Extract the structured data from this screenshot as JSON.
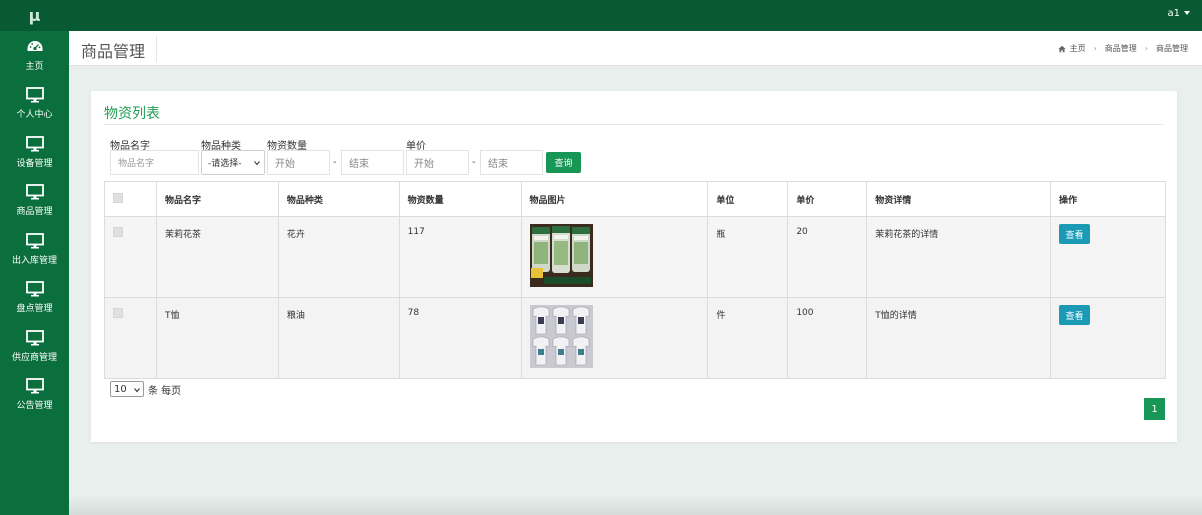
{
  "app": {
    "logo": "μ",
    "user": "a1"
  },
  "sidebar": {
    "items": [
      {
        "label": "主页",
        "icon": "dashboard-icon"
      },
      {
        "label": "个人中心",
        "icon": "monitor-icon"
      },
      {
        "label": "设备管理",
        "icon": "monitor-icon"
      },
      {
        "label": "商品管理",
        "icon": "monitor-icon"
      },
      {
        "label": "出入库管理",
        "icon": "monitor-icon"
      },
      {
        "label": "盘点管理",
        "icon": "monitor-icon"
      },
      {
        "label": "供应商管理",
        "icon": "monitor-icon"
      },
      {
        "label": "公告管理",
        "icon": "monitor-icon"
      }
    ]
  },
  "header": {
    "title": "商品管理",
    "breadcrumb": [
      "主页",
      "商品管理",
      "商品管理"
    ]
  },
  "panel": {
    "title": "物资列表",
    "filters": {
      "name_label": "物品名字",
      "name_placeholder": "物品名字",
      "type_label": "物品种类",
      "type_selected": "-请选择-",
      "qty_label": "物资数量",
      "qty_start": "开始",
      "qty_end": "结束",
      "price_label": "单价",
      "price_start": "开始",
      "price_end": "结束",
      "dash": "-",
      "search_label": "查询"
    },
    "table": {
      "headers": [
        "物品名字",
        "物品种类",
        "物资数量",
        "物品图片",
        "单位",
        "单价",
        "物资详情",
        "操作"
      ],
      "rows": [
        {
          "name": "茉莉花茶",
          "type": "花卉",
          "qty": "117",
          "image": "tea-jars-image",
          "unit": "瓶",
          "price": "20",
          "detail": "茉莉花茶的详情",
          "action": "查看"
        },
        {
          "name": "T恤",
          "type": "粮油",
          "qty": "78",
          "image": "tshirts-image",
          "unit": "件",
          "price": "100",
          "detail": "T恤的详情",
          "action": "查看"
        }
      ]
    },
    "pagination": {
      "per_page": "10",
      "per_page_text": "条 每页",
      "current_page": "1"
    }
  },
  "colors": {
    "sidebar": "#0b6e3d",
    "topbar": "#075a31",
    "accent": "#179656",
    "view_button": "#1b9ab6"
  }
}
